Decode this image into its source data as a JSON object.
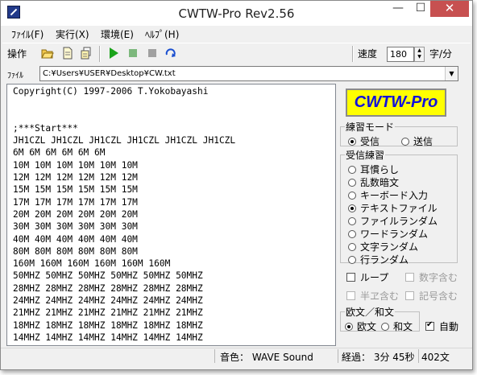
{
  "window": {
    "title": "CWTW-Pro Rev2.56",
    "minimize": "—",
    "maximize": "☐",
    "close": "✕"
  },
  "menu": {
    "items": [
      "ﾌｧｲﾙ(F)",
      "実行(X)",
      "環境(E)",
      "ﾍﾙﾌﾟ(H)"
    ]
  },
  "toolbar": {
    "label": "操作",
    "icons": [
      "open-folder-icon",
      "new-document-icon",
      "save-documents-icon",
      "play-icon",
      "stop-icon",
      "pause-icon",
      "repeat-icon"
    ],
    "speed_label": "速度",
    "speed_value": "180",
    "speed_unit": "字/分"
  },
  "filebar": {
    "label": "ﾌｧｲﾙ",
    "path": "C:¥Users¥USER¥Desktop¥CW.txt"
  },
  "text_area": {
    "lines": [
      "Copyright(C) 1997-2006 T.Yokobayashi",
      "",
      "",
      ";***Start***",
      "JH1CZL JH1CZL JH1CZL JH1CZL JH1CZL JH1CZL",
      "6M 6M 6M 6M 6M 6M",
      "10M 10M 10M 10M 10M 10M",
      "12M 12M 12M 12M 12M 12M",
      "15M 15M 15M 15M 15M 15M",
      "17M 17M 17M 17M 17M 17M",
      "20M 20M 20M 20M 20M 20M",
      "30M 30M 30M 30M 30M 30M",
      "40M 40M 40M 40M 40M 40M",
      "80M 80M 80M 80M 80M 80M",
      "160M 160M 160M 160M 160M 160M",
      "50MHZ 50MHZ 50MHZ 50MHZ 50MHZ 50MHZ",
      "28MHZ 28MHZ 28MHZ 28MHZ 28MHZ 28MHZ",
      "24MHZ 24MHZ 24MHZ 24MHZ 24MHZ 24MHZ",
      "21MHZ 21MHZ 21MHZ 21MHZ 21MHZ 21MHZ",
      "18MHZ 18MHZ 18MHZ 18MHZ 18MHZ 18MHZ",
      "14MHZ 14MHZ 14MHZ 14MHZ 14MHZ 14MHZ"
    ]
  },
  "logo": "CWTW-Pro",
  "practice_mode": {
    "legend": "練習モード",
    "options": [
      "受信",
      "送信"
    ],
    "selected": 0
  },
  "receive_practice": {
    "legend": "受信練習",
    "options": [
      "耳慣らし",
      "乱数暗文",
      "キーボード入力",
      "テキストファイル",
      "ファイルランダム",
      "ワードランダム",
      "文字ランダム",
      "行ランダム"
    ],
    "selected": 3
  },
  "options": {
    "loop": "ループ",
    "include_numbers": "数字含む",
    "include_kana": "半ヱ含む",
    "include_symbols": "記号含む"
  },
  "language": {
    "legend": "欧文／和文",
    "options": [
      "欧文",
      "和文"
    ],
    "selected": 0,
    "auto_label": "自動",
    "auto_checked": true
  },
  "status": {
    "sound": "音色： WAVE Sound",
    "elapsed": "経過： 3分 45秒",
    "chars": "402文"
  }
}
